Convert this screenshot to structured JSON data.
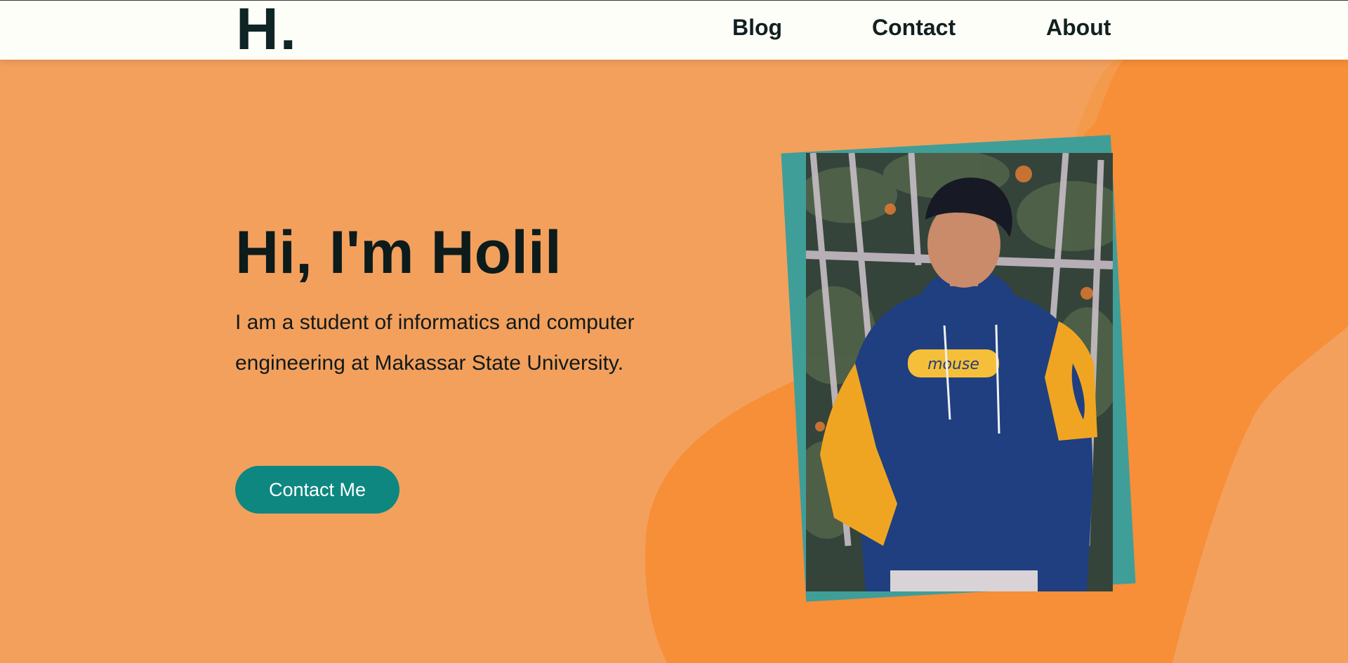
{
  "navbar": {
    "logo": "H.",
    "links": [
      {
        "label": "Blog"
      },
      {
        "label": "Contact"
      },
      {
        "label": "About"
      }
    ]
  },
  "hero": {
    "greeting": "Hi, I'm Holil",
    "bio": "I am a student of informatics and computer engineering at Makassar State University.",
    "cta_label": "Contact Me",
    "photo_alt": "Portrait photo of a young man in a blue and orange hoodie",
    "hoodie_print": "mouse"
  },
  "colors": {
    "background": "#f3a05d",
    "navbar_bg": "#fefef9",
    "accent_orange": "#f78e38",
    "accent_teal": "#0e8781",
    "photo_frame": "#409e99",
    "text_dark": "#0d1b1b"
  }
}
